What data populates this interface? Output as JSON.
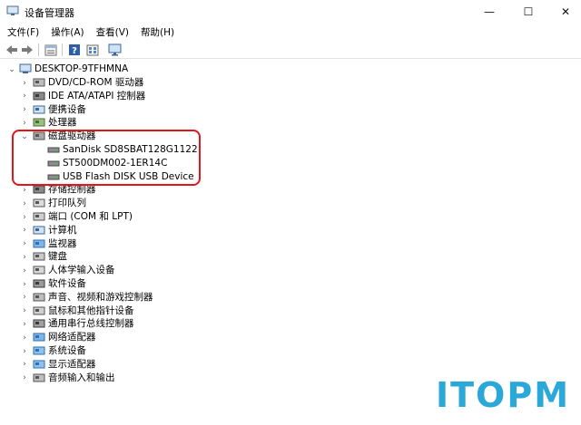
{
  "window": {
    "title": "设备管理器",
    "minimize_glyph": "—",
    "maximize_glyph": "☐",
    "close_glyph": "✕"
  },
  "menu": [
    "文件(F)",
    "操作(A)",
    "查看(V)",
    "帮助(H)"
  ],
  "toolbar": [
    {
      "name": "back-icon",
      "glyph": "◀"
    },
    {
      "name": "forward-icon",
      "glyph": "▶"
    },
    {
      "name": "properties-icon",
      "glyph": "▤"
    },
    {
      "name": "help-icon",
      "glyph": "?"
    },
    {
      "name": "details-icon",
      "glyph": "▦"
    },
    {
      "name": "monitor-icon",
      "glyph": "▣"
    }
  ],
  "tree": {
    "root": "DESKTOP-9TFHMNA",
    "items": [
      {
        "label": "DVD/CD-ROM 驱动器",
        "icon": "dvd-drive-icon",
        "expanded": false
      },
      {
        "label": "IDE ATA/ATAPI 控制器",
        "icon": "ide-controller-icon",
        "expanded": false
      },
      {
        "label": "便携设备",
        "icon": "portable-device-icon",
        "expanded": false
      },
      {
        "label": "处理器",
        "icon": "processor-icon",
        "expanded": false
      },
      {
        "label": "磁盘驱动器",
        "icon": "disk-drive-icon",
        "expanded": true,
        "children": [
          "SanDisk SD8SBAT128G1122",
          "ST500DM002-1ER14C",
          "USB Flash DISK USB Device"
        ]
      },
      {
        "label": "存储控制器",
        "icon": "storage-controller-icon",
        "expanded": false
      },
      {
        "label": "打印队列",
        "icon": "printer-icon",
        "expanded": false
      },
      {
        "label": "端口 (COM 和 LPT)",
        "icon": "port-icon",
        "expanded": false
      },
      {
        "label": "计算机",
        "icon": "computer-icon",
        "expanded": false
      },
      {
        "label": "监视器",
        "icon": "monitor-icon",
        "expanded": false
      },
      {
        "label": "键盘",
        "icon": "keyboard-icon",
        "expanded": false
      },
      {
        "label": "人体学输入设备",
        "icon": "hid-icon",
        "expanded": false
      },
      {
        "label": "软件设备",
        "icon": "software-device-icon",
        "expanded": false
      },
      {
        "label": "声音、视频和游戏控制器",
        "icon": "sound-icon",
        "expanded": false
      },
      {
        "label": "鼠标和其他指针设备",
        "icon": "mouse-icon",
        "expanded": false
      },
      {
        "label": "通用串行总线控制器",
        "icon": "usb-icon",
        "expanded": false
      },
      {
        "label": "网络适配器",
        "icon": "network-adapter-icon",
        "expanded": false
      },
      {
        "label": "系统设备",
        "icon": "system-device-icon",
        "expanded": false
      },
      {
        "label": "显示适配器",
        "icon": "display-adapter-icon",
        "expanded": false
      },
      {
        "label": "音频输入和输出",
        "icon": "audio-io-icon",
        "expanded": false
      }
    ]
  },
  "watermark": "ITOPM",
  "colors": {
    "highlight": "#e0161b",
    "watermark": "#2aa8d8"
  }
}
